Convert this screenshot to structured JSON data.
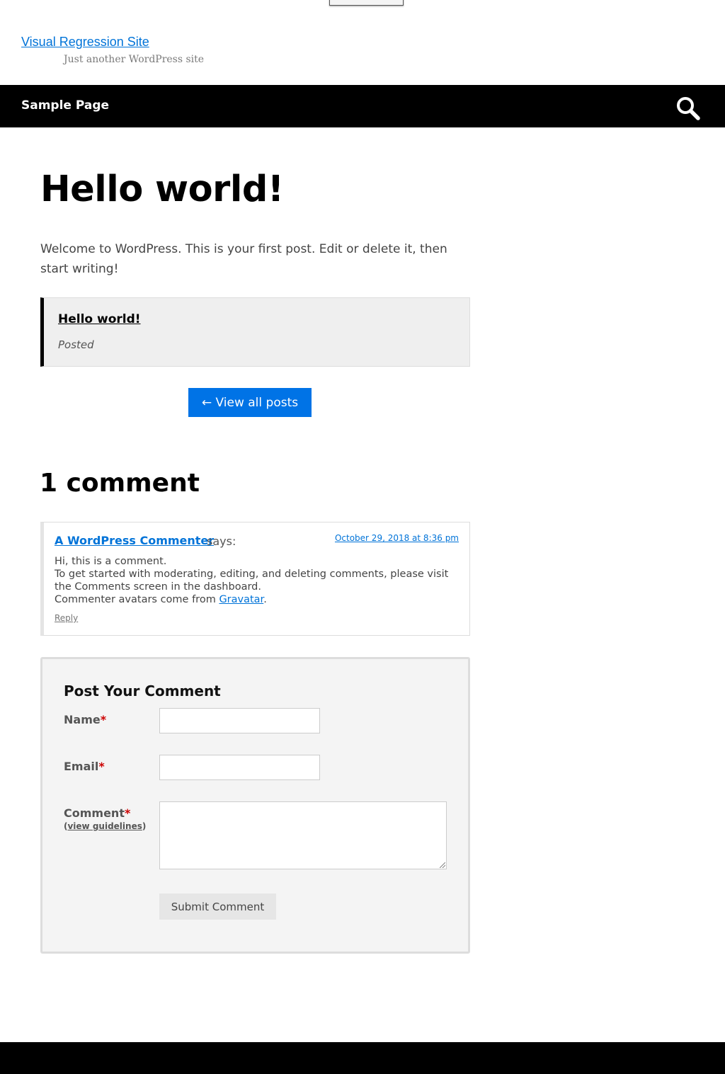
{
  "site": {
    "title": "Visual Regression Site",
    "description": "Just another WordPress site"
  },
  "nav": {
    "items": [
      {
        "label": "Sample Page"
      }
    ],
    "search_icon": "search-icon"
  },
  "post": {
    "title": "Hello world!",
    "body": "Welcome to WordPress. This is your first post. Edit or delete it, then start writing!",
    "quote": {
      "title": "Hello world!",
      "meta": "Posted"
    },
    "view_all_label": "← View all posts"
  },
  "comments": {
    "heading": "1 comment",
    "items": [
      {
        "author": "A WordPress Commenter",
        "says": "says:",
        "date": "October 29, 2018 at 8:36 pm",
        "line1": "Hi, this is a comment.",
        "line2": "To get started with moderating, editing, and deleting comments, please visit the Comments screen in the dashboard.",
        "line3_prefix": "Commenter avatars come from ",
        "line3_link": "Gravatar",
        "line3_suffix": ".",
        "reply_label": "Reply"
      }
    ]
  },
  "form": {
    "heading": "Post Your Comment",
    "name_label": "Name",
    "email_label": "Email",
    "comment_label": "Comment",
    "required_mark": "*",
    "guidelines_open": "(",
    "guidelines_link": "view guidelines",
    "guidelines_close": ")",
    "name_value": "",
    "email_value": "",
    "comment_value": "",
    "submit_label": "Submit Comment"
  },
  "colors": {
    "link": "#0073d8",
    "button": "#0073e6",
    "required": "#cc0000",
    "navbar": "#000000"
  }
}
